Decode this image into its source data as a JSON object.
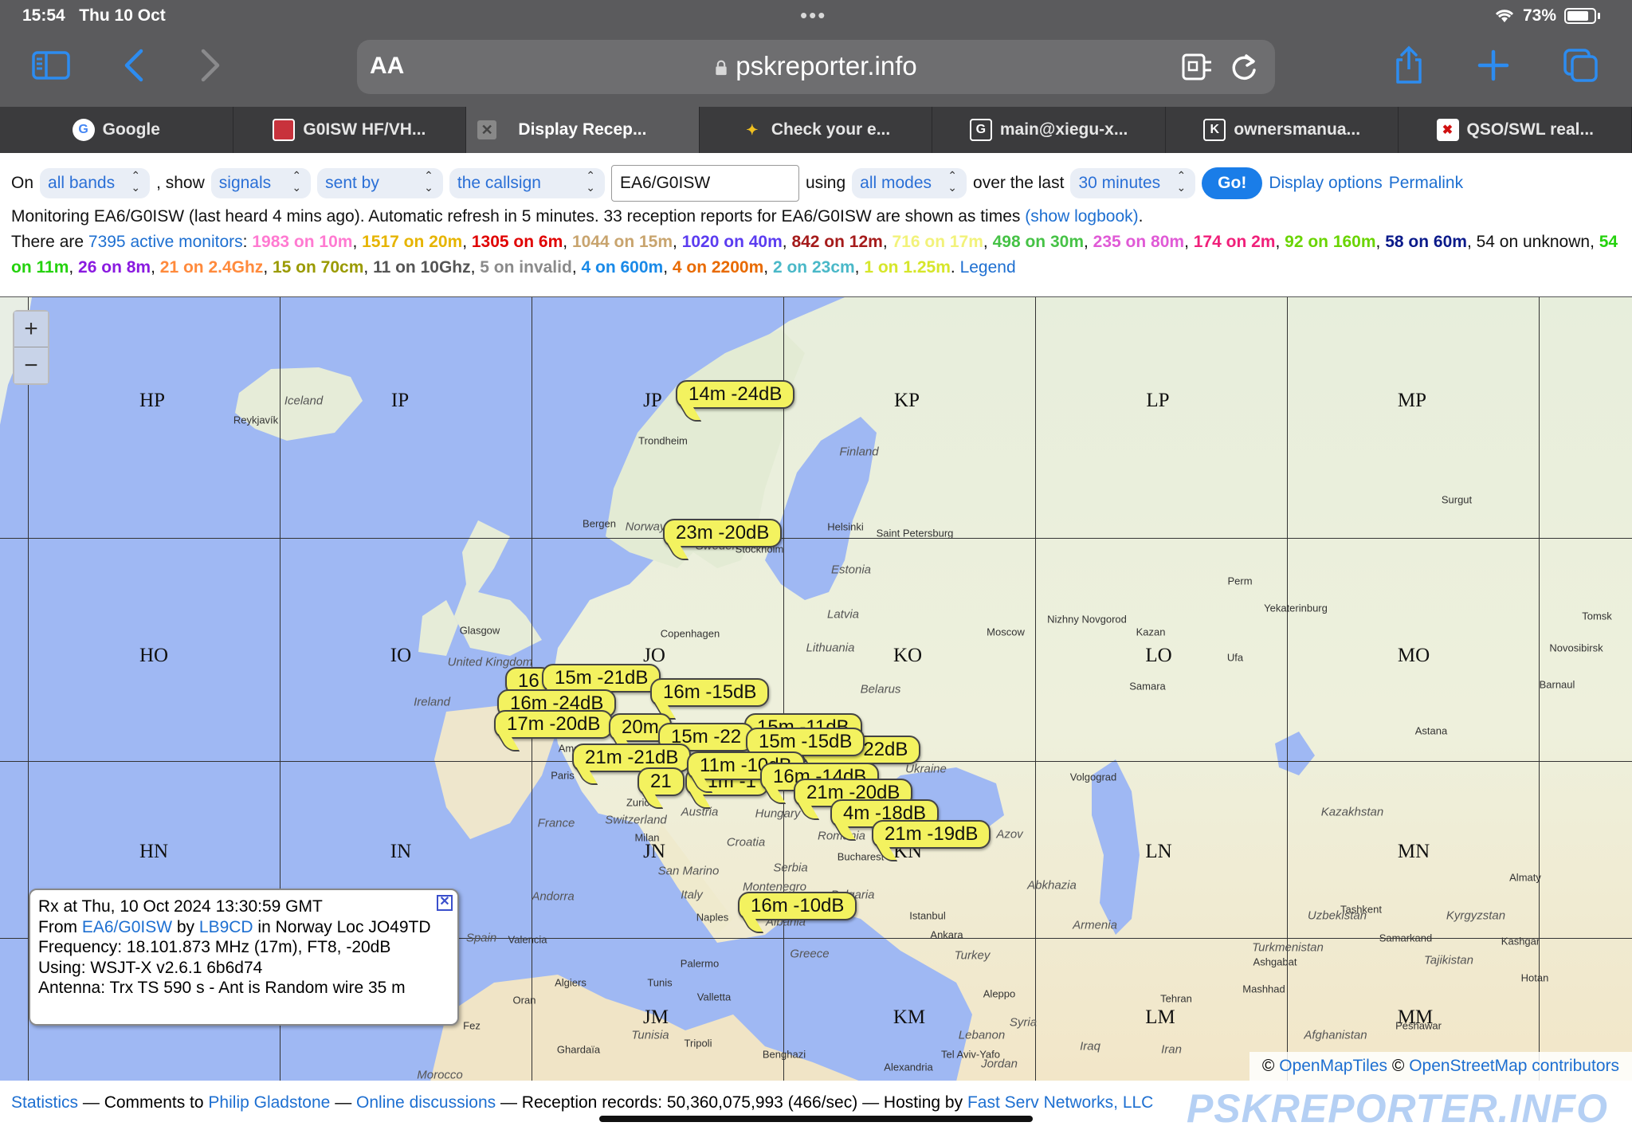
{
  "status": {
    "time": "15:54",
    "date": "Thu 10 Oct",
    "battery": "73%"
  },
  "browser": {
    "aa": "AA",
    "url": "pskreporter.info",
    "tabs": [
      {
        "label": "Google",
        "fav": "G"
      },
      {
        "label": "G0ISW HF/VH...",
        "fav": ""
      },
      {
        "label": "Display Recep...",
        "fav": ""
      },
      {
        "label": "Check your e...",
        "fav": ""
      },
      {
        "label": "main@xiegu-x...",
        "fav": "G"
      },
      {
        "label": "ownersmanua...",
        "fav": "K"
      },
      {
        "label": "QSO/SWL real...",
        "fav": ""
      }
    ]
  },
  "controls": {
    "on": "On",
    "band": "all bands",
    "comma_show": ", show",
    "show": "signals",
    "direction": "sent by",
    "target": "the callsign",
    "callsign": "EA6/G0ISW",
    "using": "using",
    "mode": "all modes",
    "over_the_last": "over the last",
    "period": "30 minutes",
    "go": "Go!",
    "display_options": "Display options",
    "permalink": "Permalink"
  },
  "info": {
    "monitoring": "Monitoring EA6/G0ISW (last heard 4 mins ago). Automatic refresh in 5 minutes. 33 reception reports for EA6/G0ISW are shown as times ",
    "show_logbook": "(show logbook)",
    "period_end": ".",
    "there_are": "There are ",
    "active_monitors": "7395 active monitors",
    "colon": ":",
    "bands": [
      {
        "text": "1983 on 10m",
        "color": "#ff7ad1"
      },
      {
        "text": "1517 on 20m",
        "color": "#e6b400"
      },
      {
        "text": "1305 on 6m",
        "color": "#e00000"
      },
      {
        "text": "1044 on 15m",
        "color": "#c8a46e"
      },
      {
        "text": "1020 on 40m",
        "color": "#5b3cf0"
      },
      {
        "text": "842 on 12m",
        "color": "#a51b1b"
      },
      {
        "text": "716 on 17m",
        "color": "#f2f27a"
      },
      {
        "text": "498 on 30m",
        "color": "#46c246"
      },
      {
        "text": "235 on 80m",
        "color": "#e05ad6"
      },
      {
        "text": "174 on 2m",
        "color": "#f0207a"
      },
      {
        "text": "92 on 160m",
        "color": "#6ad400"
      },
      {
        "text": "58 on 60m",
        "color": "#0a1a8a"
      },
      {
        "text": "54 on unknown",
        "color": "#111111"
      },
      {
        "text": "54 on 11m",
        "color": "#25d20e"
      },
      {
        "text": "26 on 8m",
        "color": "#8a1ae0"
      },
      {
        "text": "21 on 2.4Ghz",
        "color": "#ff8a3c"
      },
      {
        "text": "15 on 70cm",
        "color": "#9a9a00"
      },
      {
        "text": "11 on 10Ghz",
        "color": "#555555"
      },
      {
        "text": "5 on invalid",
        "color": "#8a8a8a"
      },
      {
        "text": "4 on 600m",
        "color": "#1a8ae8"
      },
      {
        "text": "4 on 2200m",
        "color": "#e86a00"
      },
      {
        "text": "2 on 23cm",
        "color": "#4ab8c8"
      },
      {
        "text": "1 on 1.25m",
        "color": "#d6e62a"
      }
    ],
    "legend": "Legend"
  },
  "map": {
    "zoom_in": "+",
    "zoom_out": "−",
    "locators": [
      "HP",
      "IP",
      "JP",
      "KP",
      "LP",
      "MP",
      "HO",
      "IO",
      "JO",
      "KO",
      "LO",
      "MO",
      "HN",
      "IN",
      "JN",
      "KN",
      "LN",
      "MN",
      "JM",
      "KM",
      "LM",
      "MM"
    ],
    "places": [
      "Reykjavík",
      "Trondheim",
      "Bergen",
      "Stockholm",
      "Helsinki",
      "Saint Petersburg",
      "Surgut",
      "Glasgow",
      "Copenhagen",
      "Moscow",
      "Nizhny Novgorod",
      "Kazan",
      "Yekaterinburg",
      "Perm",
      "Tomsk",
      "Novosibirsk",
      "Barnaul",
      "Ufa",
      "Samara",
      "Astana",
      "Volgograd",
      "Paris",
      "Milan",
      "Zurich",
      "Bucharest",
      "Naples",
      "Palermo",
      "Istanbul",
      "Ankara",
      "Valencia",
      "Algiers",
      "Tunis",
      "Oran",
      "Valletta",
      "Tripoli",
      "Benghazi",
      "Alexandria",
      "Tel Aviv-Yafo",
      "Aleppo",
      "Tehran",
      "Mashhad",
      "Ashgabat",
      "Tashkent",
      "Samarkand",
      "Almaty",
      "Kashgar",
      "Hotan",
      "Peshawar",
      "Ghardaïa",
      "Fez",
      "Amsterdam"
    ],
    "countries": [
      "Iceland",
      "Finland",
      "Norway",
      "Sweden",
      "Estonia",
      "Latvia",
      "Lithuania",
      "Belarus",
      "Ukraine",
      "United Kingdom",
      "Ireland",
      "France",
      "Switzerland",
      "Austria",
      "Hungary",
      "Croatia",
      "Romania",
      "Serbia",
      "Montenegro",
      "Bulgaria",
      "Albania",
      "Greece",
      "Italy",
      "San Marino",
      "Andorra",
      "Spain",
      "Turkey",
      "Syria",
      "Lebanon",
      "Iraq",
      "Iran",
      "Jordan",
      "Armenia",
      "Abkhazia",
      "Kazakhstan",
      "Uzbekistan",
      "Turkmenistan",
      "Kyrgyzstan",
      "Tajikistan",
      "Afghanistan",
      "Tunisia",
      "Azov",
      "Morocco"
    ],
    "bubbles": [
      "14m -24dB",
      "23m -20dB",
      "15m -21dB",
      "16m -15dB",
      "16m -24dB",
      "17m -20dB",
      "20m",
      "15m -22",
      "15m -15dB",
      "21m -21dB",
      "11m -10dB",
      "16m -14dB",
      "21m -20dB",
      "4m -18dB",
      "21m -19dB",
      "16m -10dB",
      "16",
      "21",
      "10m -22dB",
      "15m -11dB",
      "10dB",
      "21",
      "11m -1"
    ],
    "popup": {
      "line1": "Rx at Thu, 10 Oct 2024 13:30:59 GMT",
      "from": "From ",
      "from_call": "EA6/G0ISW",
      "by": " by ",
      "by_call": "LB9CD",
      "loc": " in Norway Loc JO49TD",
      "frequency": "Frequency: 18.101.873 MHz (17m), FT8, -20dB",
      "using": "Using: WSJT-X v2.6.1 6b6d74",
      "antenna": "Antenna: Trx TS 590 s - Ant is Random wire 35 m"
    },
    "attribution": {
      "c1": "©",
      "openmaptiles": "OpenMapTiles",
      "c2": " © ",
      "osm": "OpenStreetMap contributors"
    }
  },
  "footer": {
    "statistics": "Statistics",
    "dash1": " — Comments to ",
    "philip": "Philip Gladstone",
    "dash2": " — ",
    "online": "Online discussions",
    "records": " — Reception records: 50,360,075,993 (466/sec) — Hosting by ",
    "hosting": "Fast Serv Networks, LLC",
    "watermark": "PSKREPORTER.INFO"
  }
}
